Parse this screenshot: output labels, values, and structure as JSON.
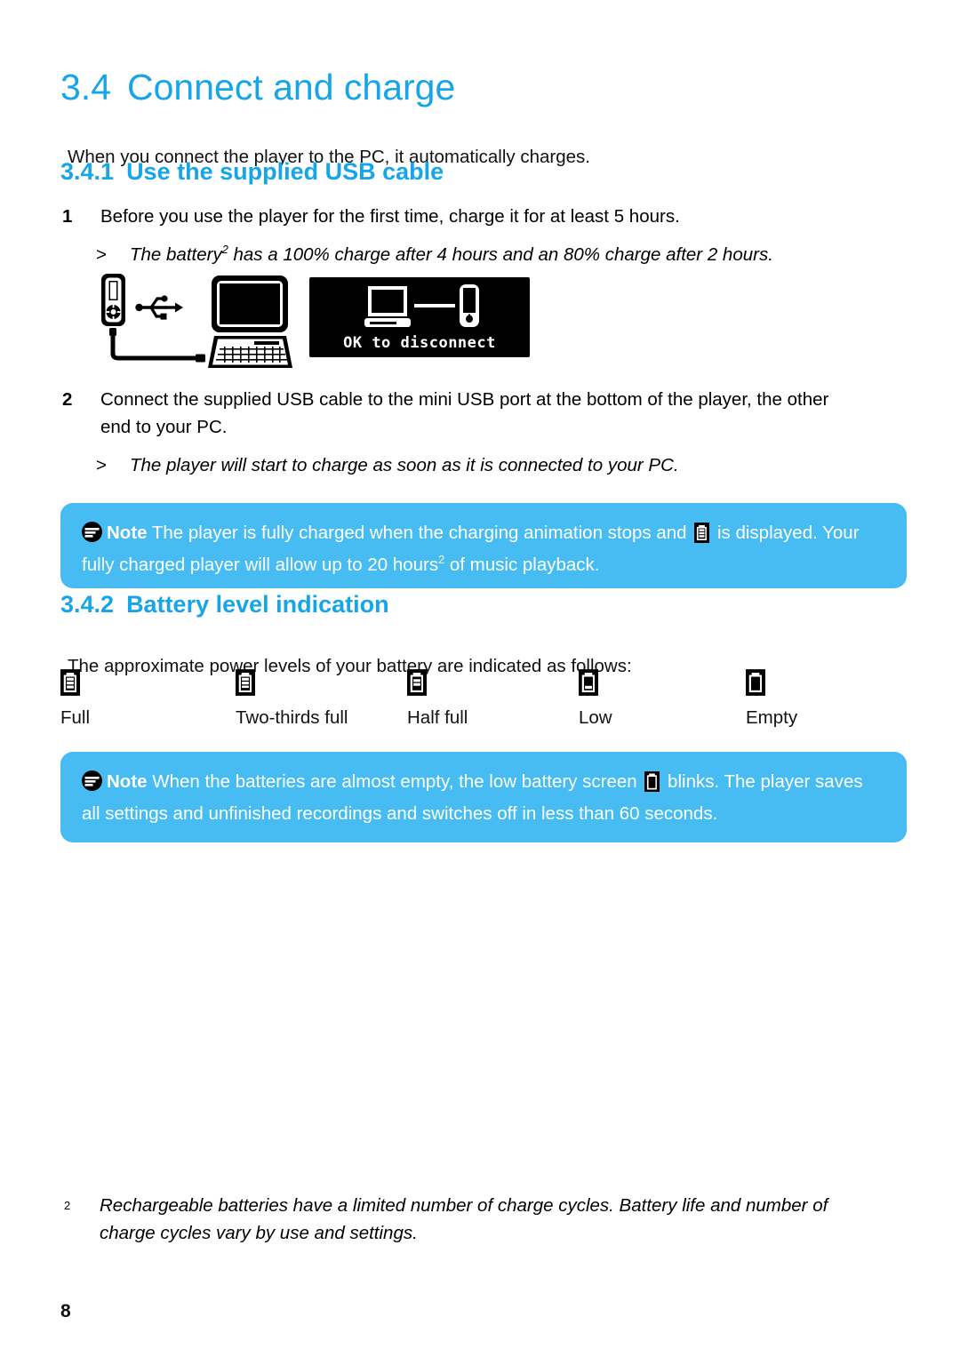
{
  "document": {
    "section_number": "3.4",
    "section_title": "Connect and charge",
    "intro": "When you connect the player to the PC, it automatically charges.",
    "page_number": "8"
  },
  "subsection_341": {
    "number": "3.4.1",
    "title": "Use the supplied USB cable",
    "steps": [
      {
        "marker": "1",
        "text": "Before you use the player for the first time, charge it for at least 5 hours."
      },
      {
        "marker": "2",
        "text": "Connect the supplied USB cable to the mini USB port at the bottom of the player, the other end to your PC."
      }
    ],
    "sub_notes": [
      {
        "marker": ">",
        "text_before_sup": "The battery",
        "sup": "2",
        "text_after_sup": " has a 100% charge after 4 hours and an 80% charge after 2 hours."
      },
      {
        "marker": ">",
        "text": "The player will start to charge as soon as it is connected to your PC."
      }
    ]
  },
  "figure": {
    "usb_illustration_name": "player-usb-pc-illustration",
    "screen": {
      "icon_name": "pc-to-player-connected-icon",
      "label": "OK to disconnect"
    }
  },
  "note_1": {
    "icon_name": "note-icon",
    "label": "Note",
    "text_part_1": " The player is fully charged when the charging animation stops and ",
    "battery_icon_name": "battery-full-icon",
    "text_part_2": " is displayed. Your fully charged player will allow up to 20 hours",
    "sup": "2",
    "text_part_3": " of music playback."
  },
  "subsection_342": {
    "number": "3.4.2",
    "title": "Battery level indication",
    "description": "The approximate power levels of your battery are indicated as follows:",
    "levels": [
      {
        "label": "Full",
        "icon_name": "battery-full-icon",
        "segments": 3,
        "percent": 100
      },
      {
        "label": "Two-thirds full",
        "icon_name": "battery-two-thirds-icon",
        "segments": 3,
        "percent": 66
      },
      {
        "label": "Half full",
        "icon_name": "battery-half-icon",
        "segments": 2,
        "percent": 50
      },
      {
        "label": "Low",
        "icon_name": "battery-low-icon",
        "segments": 1,
        "percent": 20
      },
      {
        "label": "Empty",
        "icon_name": "battery-empty-icon",
        "segments": 0,
        "percent": 0
      }
    ]
  },
  "note_2": {
    "icon_name": "note-icon",
    "label": "Note",
    "text_part_1": " When the batteries are almost empty, the low battery screen ",
    "battery_icon_name": "battery-empty-icon",
    "text_part_2": " blinks. The player saves all settings and unfinished recordings and switches off in less than 60 seconds."
  },
  "footnote": {
    "marker": "2",
    "text": "Rechargeable batteries have a limited number of charge cycles. Battery life and number of charge cycles vary by use and settings."
  },
  "colors": {
    "brand_blue": "#16a5e8",
    "note_blue": "#46bcf2",
    "text_black": "#111111"
  }
}
